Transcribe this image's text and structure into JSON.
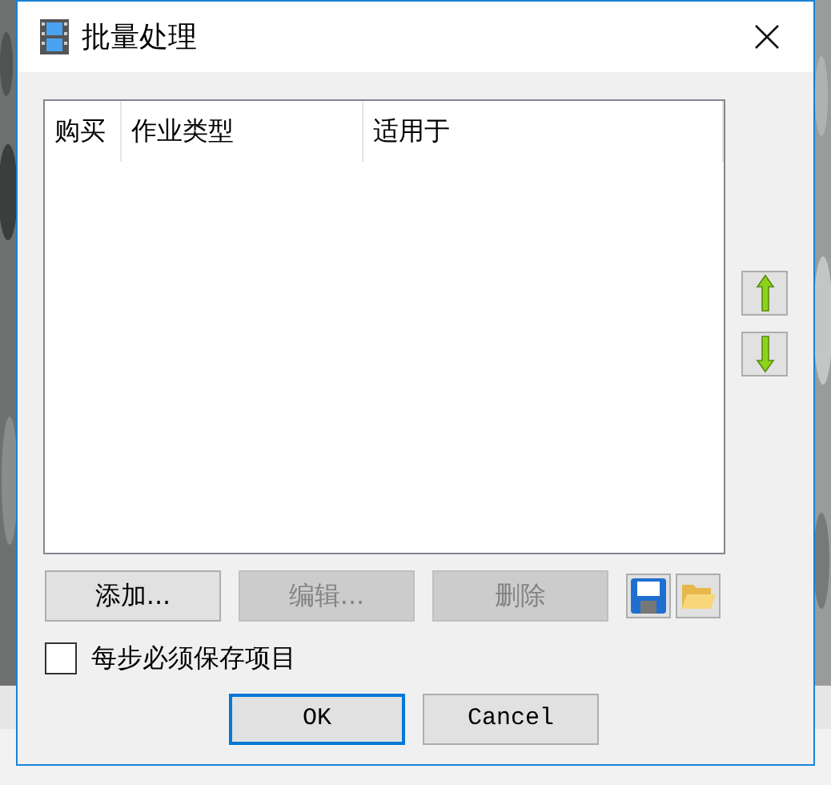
{
  "window": {
    "title": "批量处理"
  },
  "table": {
    "columns": [
      "购买",
      "作业类型",
      "适用于"
    ]
  },
  "buttons": [
    {
      "label": "添加...",
      "disabled": false
    },
    {
      "label": "编辑...",
      "disabled": true
    },
    {
      "label": "删除",
      "disabled": true
    }
  ],
  "checkbox": {
    "label": "每步必须保存项目",
    "checked": false
  },
  "dialog_buttons": [
    {
      "label": "OK",
      "default": true
    },
    {
      "label": "Cancel",
      "default": false
    }
  ]
}
